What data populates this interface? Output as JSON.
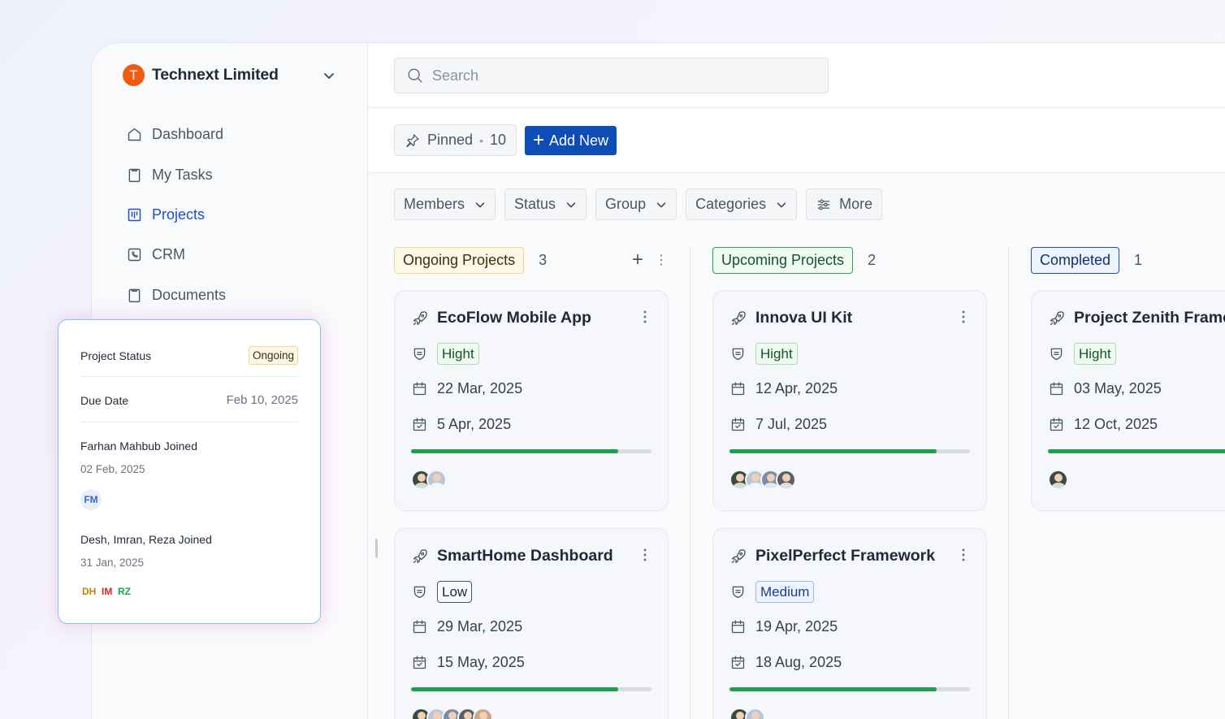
{
  "org": {
    "name": "Technext Limited",
    "logo_letter": "T"
  },
  "nav": [
    {
      "label": "Dashboard",
      "icon": "home-icon",
      "active": false
    },
    {
      "label": "My Tasks",
      "icon": "clipboard-icon",
      "active": false
    },
    {
      "label": "Projects",
      "icon": "kanban-icon",
      "active": true
    },
    {
      "label": "CRM",
      "icon": "phone-icon",
      "active": false
    },
    {
      "label": "Documents",
      "icon": "document-icon",
      "active": false
    }
  ],
  "search": {
    "placeholder": "Search"
  },
  "toolbar": {
    "pinned_label": "Pinned",
    "pinned_count": "10",
    "add_new_label": "Add New"
  },
  "filters": {
    "members": "Members",
    "status": "Status",
    "group": "Group",
    "categories": "Categories",
    "more": "More"
  },
  "columns": [
    {
      "title": "Ongoing Projects",
      "count": "3",
      "tag_color": "#f2d68c",
      "cards": [
        {
          "title": "EcoFlow Mobile App",
          "priority": "Hight",
          "start": "22 Mar, 2025",
          "end": "5 Apr, 2025",
          "progress": 0.86,
          "avatars": 2
        },
        {
          "title": "SmartHome Dashboard",
          "priority": "Low",
          "start": "29 Mar, 2025",
          "end": "15 May, 2025",
          "progress": 0.86,
          "avatars": 5
        }
      ]
    },
    {
      "title": "Upcoming Projects",
      "count": "2",
      "tag_color": "#2fa054",
      "cards": [
        {
          "title": "Innova UI Kit",
          "priority": "Hight",
          "start": "12 Apr, 2025",
          "end": "7 Jul, 2025",
          "progress": 0.86,
          "avatars": 4
        },
        {
          "title": "PixelPerfect Framework",
          "priority": "Medium",
          "start": "19 Apr, 2025",
          "end": "18 Aug, 2025",
          "progress": 0.86,
          "avatars": 2
        }
      ]
    },
    {
      "title": "Completed",
      "count": "1",
      "tag_color": "#1f4fa8",
      "cards": [
        {
          "title": "Project Zenith Frame",
          "priority": "Hight",
          "start": "03 May, 2025",
          "end": "12 Oct, 2025",
          "progress": 1.0,
          "avatars": 1
        }
      ]
    }
  ],
  "popup": {
    "status_label": "Project Status",
    "status_value": "Ongoing",
    "due_label": "Due Date",
    "due_value": "Feb 10, 2025",
    "activity": [
      {
        "title": "Farhan Mahbub Joined",
        "date": "02 Feb, 2025",
        "initials": [
          "FM"
        ]
      },
      {
        "title": "Desh, Imran, Reza Joined",
        "date": "31 Jan, 2025",
        "initials": [
          "DH",
          "IM",
          "RZ"
        ]
      }
    ]
  },
  "colors": {
    "primary": "#0d4db5",
    "progress": "#1ca04b",
    "brand": "#f25a0f"
  }
}
